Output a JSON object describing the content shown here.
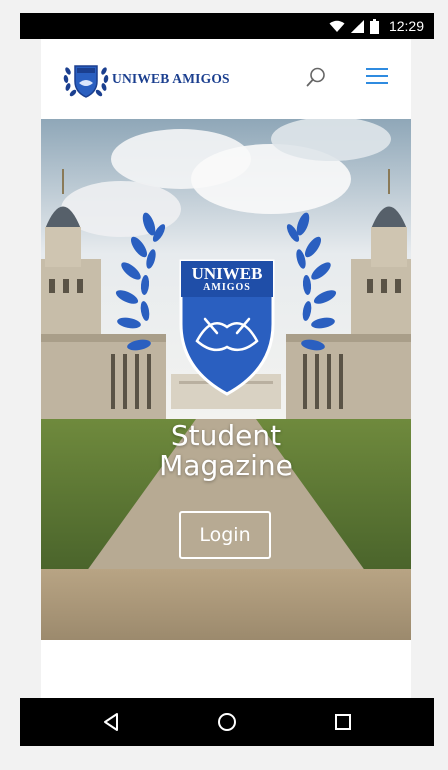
{
  "status_bar": {
    "time": "12:29",
    "icons": [
      "wifi-icon",
      "signal-icon",
      "battery-icon"
    ]
  },
  "header": {
    "logo_text": "UNIWEB AMIGOS",
    "search_icon": "search-icon",
    "menu_icon": "hamburger-menu-icon"
  },
  "hero": {
    "crest_line1": "UNIWEB",
    "crest_line2": "AMIGOS",
    "title_line1": "Student",
    "title_line2": "Magazine",
    "login_label": "Login"
  },
  "nav_bar": {
    "icons": [
      "back-icon",
      "home-icon",
      "recents-icon"
    ]
  },
  "colors": {
    "brand_blue": "#1b3f8f",
    "accent_blue": "#2f8be0",
    "crest_blue": "#2a5fc0",
    "system_bar": "#000000"
  }
}
